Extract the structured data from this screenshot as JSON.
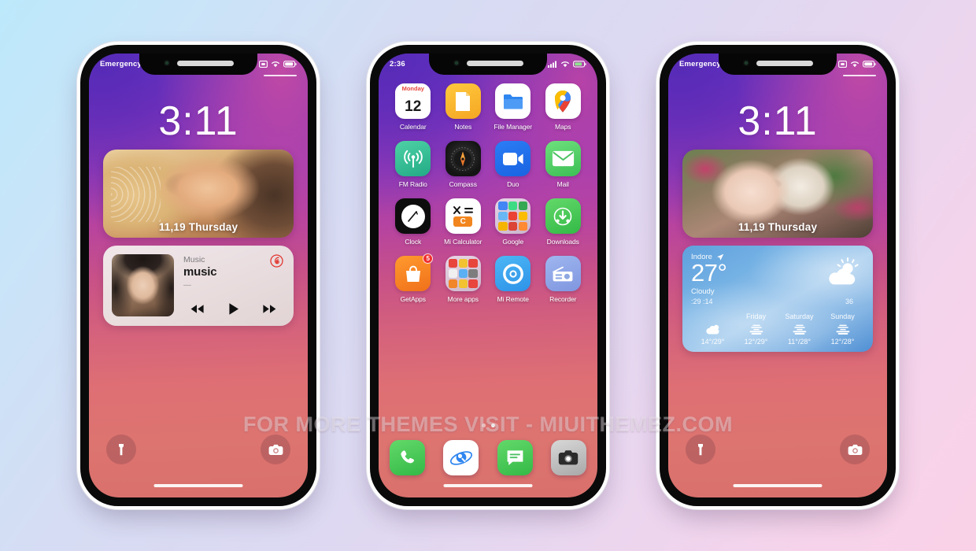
{
  "watermark": "FOR MORE THEMES VISIT - MIUITHEMEZ.COM",
  "phones": {
    "lock_left": {
      "status": {
        "carrier": "Emergency c.",
        "icons": [
          "cast-icon",
          "wifi-icon",
          "battery-icon"
        ]
      },
      "clock": "3:11",
      "photo_widget": {
        "date": "11,19 Thursday"
      },
      "music_widget": {
        "app_label": "Music",
        "title": "music",
        "subtitle": "—",
        "logo": "netease-music-icon",
        "controls": [
          "previous-track",
          "play",
          "next-track"
        ]
      },
      "actions": {
        "left": "flashlight",
        "right": "camera"
      }
    },
    "home_center": {
      "status": {
        "time": "2:36",
        "icons": [
          "signal-icon",
          "wifi-icon",
          "battery-icon"
        ]
      },
      "apps": [
        {
          "label": "Calendar",
          "icon": "calendar-icon",
          "cal_month": "Monday",
          "cal_day": "12"
        },
        {
          "label": "Notes",
          "icon": "notes-icon"
        },
        {
          "label": "File Manager",
          "icon": "file-manager-icon"
        },
        {
          "label": "Maps",
          "icon": "maps-icon"
        },
        {
          "label": "FM Radio",
          "icon": "fm-radio-icon"
        },
        {
          "label": "Compass",
          "icon": "compass-icon"
        },
        {
          "label": "Duo",
          "icon": "duo-icon"
        },
        {
          "label": "Mail",
          "icon": "mail-icon"
        },
        {
          "label": "Clock",
          "icon": "clock-icon"
        },
        {
          "label": "Mi Calculator",
          "icon": "calculator-icon"
        },
        {
          "label": "Google",
          "icon": "google-folder-icon"
        },
        {
          "label": "Downloads",
          "icon": "downloads-icon"
        },
        {
          "label": "GetApps",
          "icon": "getapps-icon",
          "badge": "5"
        },
        {
          "label": "More apps",
          "icon": "more-apps-folder-icon"
        },
        {
          "label": "Mi Remote",
          "icon": "mi-remote-icon"
        },
        {
          "label": "Recorder",
          "icon": "recorder-icon"
        }
      ],
      "dock": [
        {
          "label": "Phone",
          "icon": "phone-icon"
        },
        {
          "label": "Browser",
          "icon": "browser-icon"
        },
        {
          "label": "Messages",
          "icon": "messages-icon"
        },
        {
          "label": "Camera",
          "icon": "camera-icon"
        }
      ],
      "page_dots": {
        "count": 2,
        "active": 1
      }
    },
    "lock_right": {
      "status": {
        "carrier": "Emergency c.",
        "icons": [
          "cast-icon",
          "wifi-icon",
          "battery-icon"
        ]
      },
      "clock": "3:11",
      "photo_widget": {
        "date": "11,19 Thursday"
      },
      "weather_widget": {
        "city": "Indore",
        "location_icon": "location-arrow-icon",
        "temperature": "27°",
        "condition": "Cloudy",
        "metric_left": ":29 :14",
        "metric_right": "36",
        "main_icon": "sun-behind-cloud-icon",
        "forecast": [
          {
            "day": "",
            "icon": "cloud-sun-icon",
            "range": "14°/29°"
          },
          {
            "day": "Friday",
            "icon": "haze-icon",
            "range": "12°/29°"
          },
          {
            "day": "Saturday",
            "icon": "haze-icon",
            "range": "11°/28°"
          },
          {
            "day": "Sunday",
            "icon": "haze-icon",
            "range": "12°/28°"
          }
        ]
      },
      "actions": {
        "left": "flashlight",
        "right": "camera"
      }
    }
  },
  "colors": {
    "background_start": "#bce9fb",
    "background_end": "#fad2e8",
    "wallpaper_top": "#6034c4",
    "wallpaper_bottom": "#d9706c",
    "badge": "#f03030",
    "weather_blue": "#5fa0dd"
  }
}
